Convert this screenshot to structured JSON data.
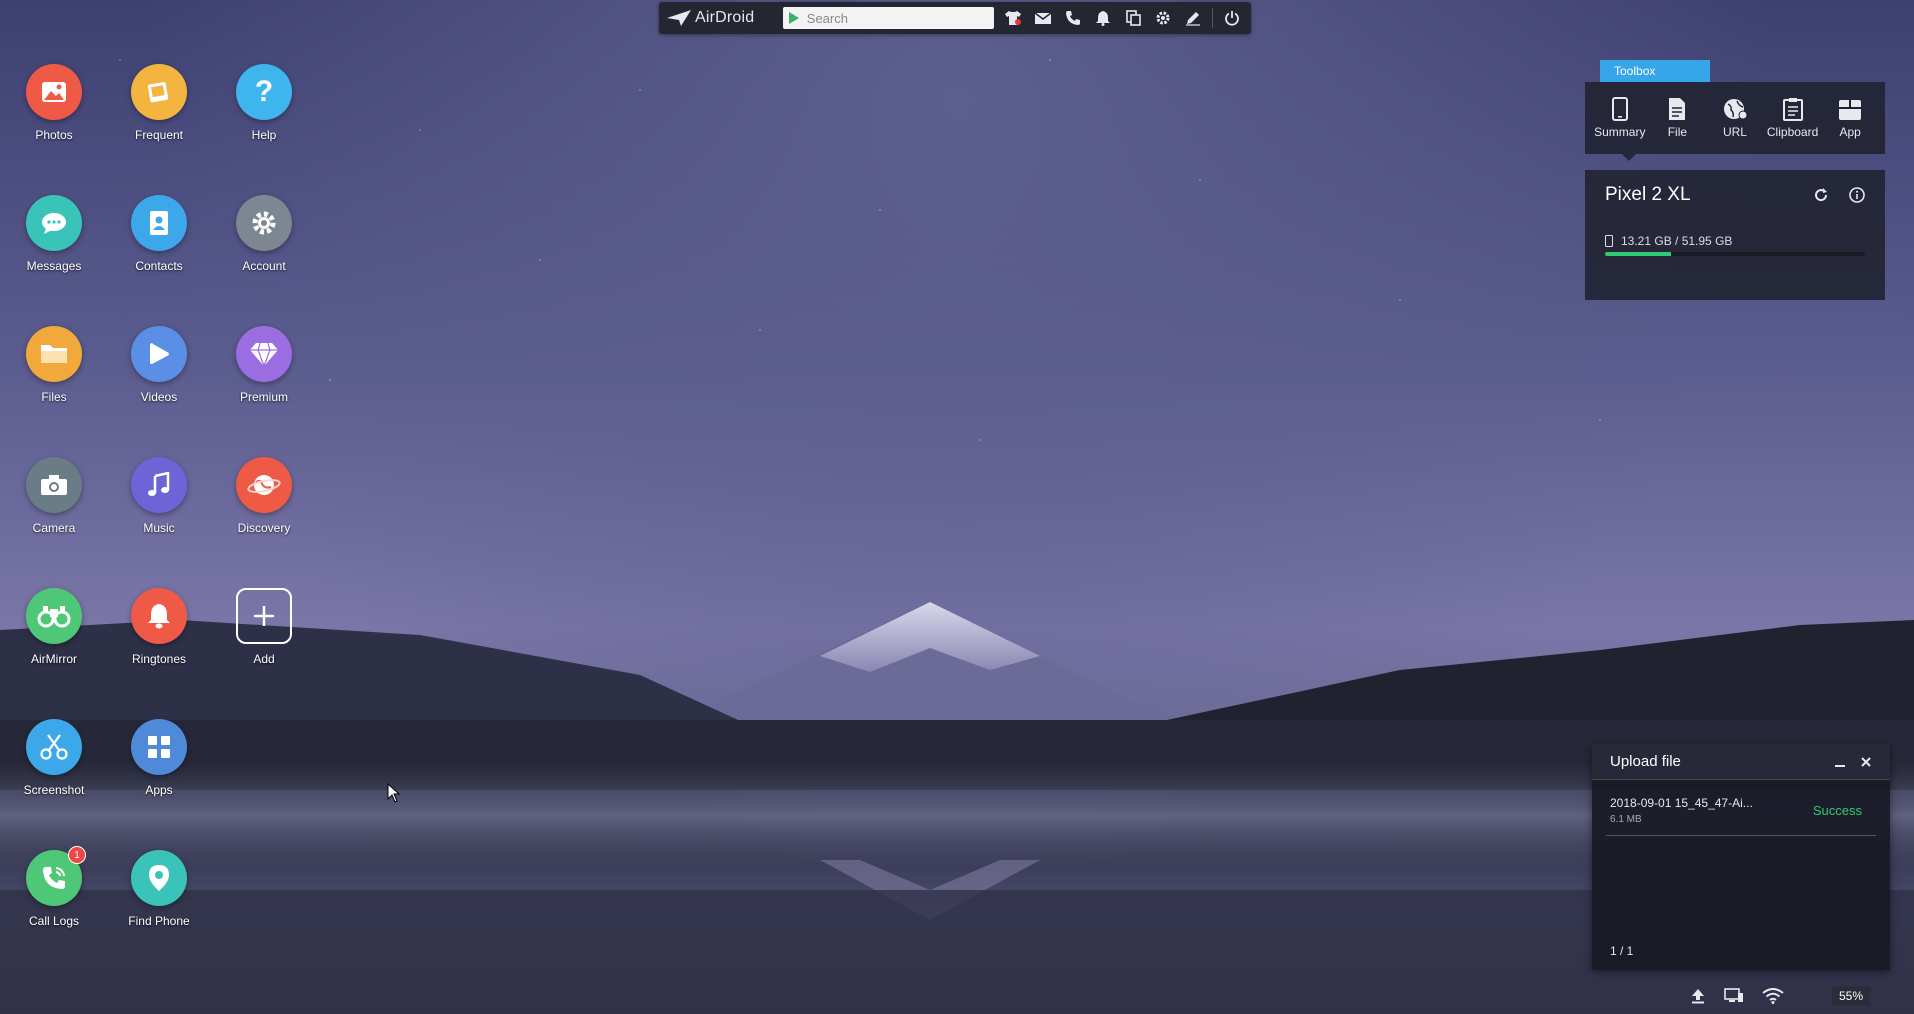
{
  "toolbar": {
    "logo": "AirDroid",
    "search_placeholder": "Search",
    "icons": [
      "shirt-icon",
      "mail-icon",
      "phone-icon",
      "bell-icon",
      "copy-icon",
      "gear-icon",
      "pen-icon",
      "power-icon"
    ]
  },
  "desktop": {
    "apps": [
      {
        "label": "Photos",
        "icon": "photos-icon",
        "color": "#ef5a47"
      },
      {
        "label": "Frequent",
        "icon": "frequent-icon",
        "color": "#f3b53f"
      },
      {
        "label": "Help",
        "icon": "help-icon",
        "color": "#3fb5ee"
      },
      {
        "label": "Messages",
        "icon": "messages-icon",
        "color": "#39c3b9"
      },
      {
        "label": "Contacts",
        "icon": "contacts-icon",
        "color": "#3da8e9"
      },
      {
        "label": "Account",
        "icon": "gear-icon",
        "color": "#7e8791"
      },
      {
        "label": "Files",
        "icon": "folder-icon",
        "color": "#f0a93a"
      },
      {
        "label": "Videos",
        "icon": "play-icon",
        "color": "#5a8fe5"
      },
      {
        "label": "Premium",
        "icon": "diamond-icon",
        "color": "#9a6ee0"
      },
      {
        "label": "Camera",
        "icon": "camera-icon",
        "color": "#6a7c86"
      },
      {
        "label": "Music",
        "icon": "music-icon",
        "color": "#6f63d8"
      },
      {
        "label": "Discovery",
        "icon": "planet-icon",
        "color": "#ef5a47"
      },
      {
        "label": "AirMirror",
        "icon": "binoculars-icon",
        "color": "#4ec777"
      },
      {
        "label": "Ringtones",
        "icon": "bell-icon",
        "color": "#ef5a47"
      },
      {
        "label": "Add",
        "icon": "plus-icon",
        "color": "transparent"
      },
      {
        "label": "Screenshot",
        "icon": "scissors-icon",
        "color": "#3da8e9"
      },
      {
        "label": "Apps",
        "icon": "grid-icon",
        "color": "#4f8ad9"
      },
      {
        "label": "Call Logs",
        "icon": "call-icon",
        "color": "#4ec777",
        "badge": "1"
      },
      {
        "label": "Find Phone",
        "icon": "location-icon",
        "color": "#39c3b9"
      }
    ]
  },
  "toolbox": {
    "tab_label": "Toolbox",
    "tools": [
      {
        "label": "Summary",
        "icon": "phone-device-icon"
      },
      {
        "label": "File",
        "icon": "file-icon"
      },
      {
        "label": "URL",
        "icon": "globe-icon"
      },
      {
        "label": "Clipboard",
        "icon": "clipboard-icon"
      },
      {
        "label": "App",
        "icon": "app-box-icon"
      }
    ]
  },
  "device": {
    "name": "Pixel 2 XL",
    "storage_text": "13.21 GB / 51.95 GB",
    "storage_used_fraction": 0.254
  },
  "upload": {
    "title": "Upload file",
    "items": [
      {
        "name": "2018-09-01 15_45_47-Ai...",
        "size": "6.1 MB",
        "status": "Success"
      }
    ],
    "count": "1 / 1"
  },
  "tray": {
    "battery": "55%"
  },
  "colors": {
    "accent": "#36a6e9",
    "success": "#2ecc71"
  }
}
